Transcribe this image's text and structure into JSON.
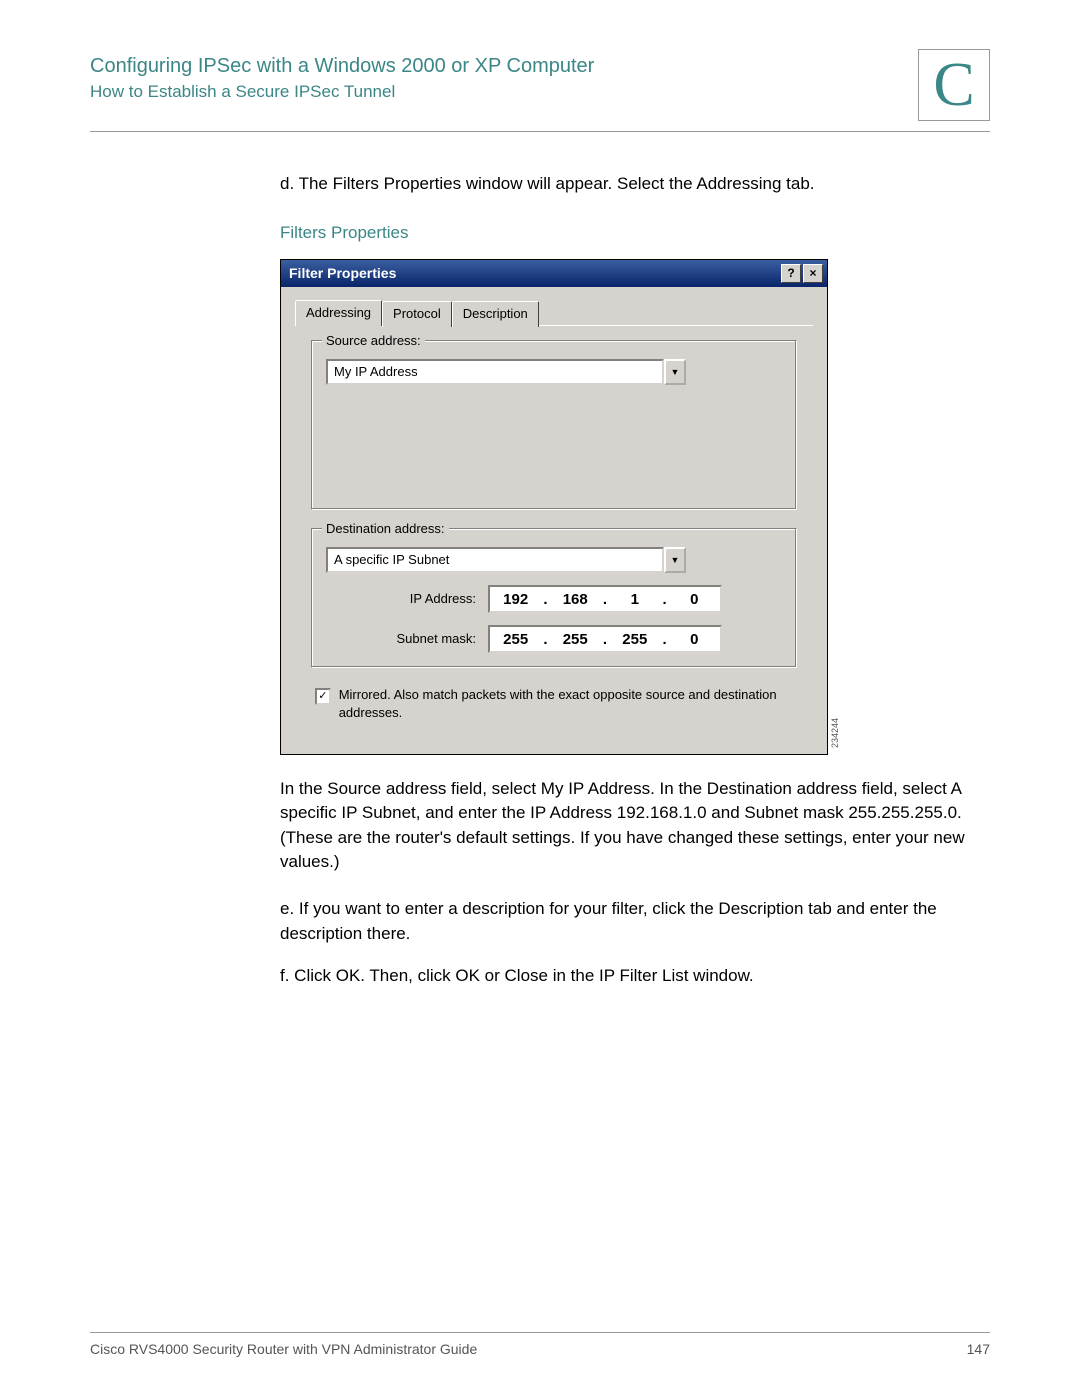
{
  "header": {
    "title": "Configuring IPSec with a Windows 2000 or XP Computer",
    "subtitle": "How to Establish a Secure IPSec Tunnel",
    "appendix_letter": "C"
  },
  "body": {
    "step_d": "d.  The Filters Properties window will appear. Select the Addressing tab.",
    "caption": "Filters Properties",
    "para_after_fig": "In the Source address field, select My IP Address. In the Destination address field, select A specific IP Subnet, and enter the IP Address 192.168.1.0 and Subnet mask 255.255.255.0. (These are the router's default settings. If you have changed these settings, enter your new values.)",
    "step_e": "e.  If you want to enter a description for your filter, click the Description tab and enter the description there.",
    "step_f": "f.   Click OK. Then, click OK or Close in the IP Filter List window."
  },
  "dialog": {
    "title": "Filter Properties",
    "help_glyph": "?",
    "close_glyph": "×",
    "tabs": {
      "addressing": "Addressing",
      "protocol": "Protocol",
      "description": "Description"
    },
    "source": {
      "legend": "Source address:",
      "value": "My IP Address",
      "arrow": "▼"
    },
    "dest": {
      "legend": "Destination address:",
      "value": "A specific IP Subnet",
      "arrow": "▼",
      "ip_label": "IP Address:",
      "ip": {
        "o1": "192",
        "o2": "168",
        "o3": "1",
        "o4": "0"
      },
      "mask_label": "Subnet mask:",
      "mask": {
        "o1": "255",
        "o2": "255",
        "o3": "255",
        "o4": "0"
      }
    },
    "mirror": {
      "check": "✓",
      "text": "Mirrored. Also match packets with the exact opposite source and destination addresses."
    },
    "side_code": "234244"
  },
  "footer": {
    "left": "Cisco RVS4000 Security Router with VPN Administrator Guide",
    "right": "147"
  }
}
